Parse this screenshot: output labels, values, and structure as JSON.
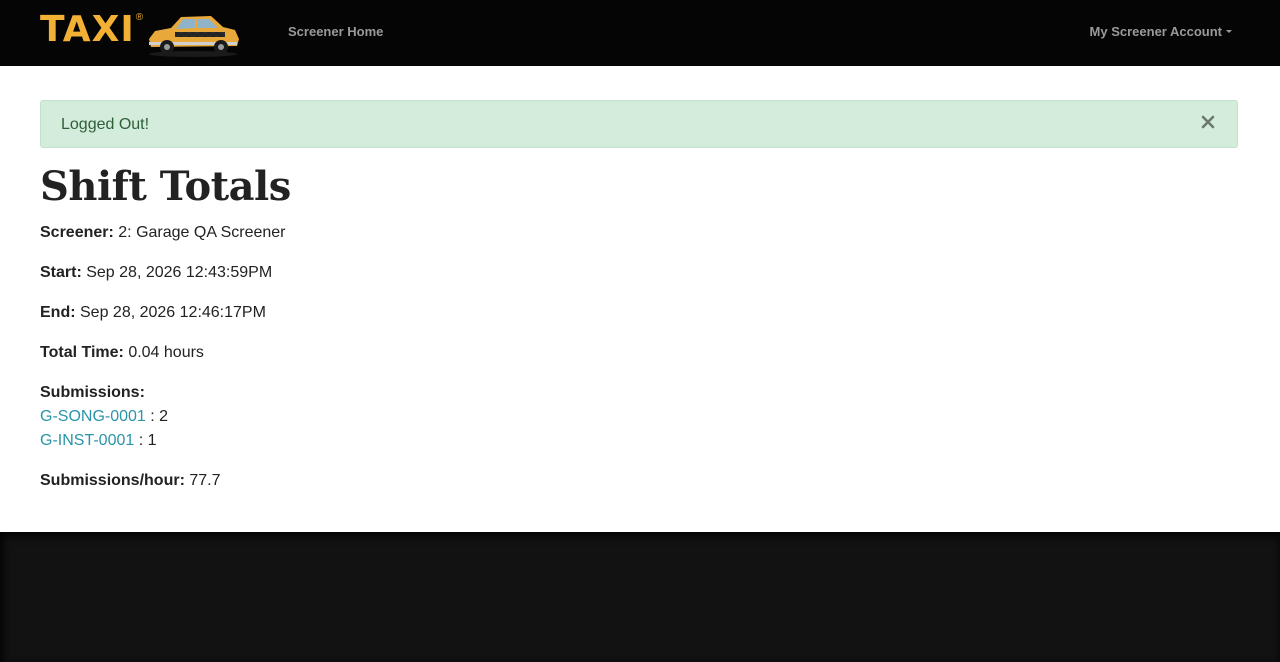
{
  "navbar": {
    "brand_text": "TAXI",
    "brand_mark": "®",
    "home_link": "Screener Home",
    "account_menu": "My Screener Account"
  },
  "alert": {
    "message": "Logged Out!",
    "close_label": "×"
  },
  "page": {
    "title": "Shift Totals"
  },
  "shift": {
    "screener_label": "Screener:",
    "screener_value": "2: Garage QA Screener",
    "start_label": "Start:",
    "start_value": "Sep 28, 2026 12:43:59PM",
    "end_label": "End:",
    "end_value": "Sep 28, 2026 12:46:17PM",
    "total_label": "Total Time:",
    "total_value": "0.04 hours",
    "submissions_label": "Submissions:",
    "submissions": [
      {
        "code": "G-SONG-0001",
        "sep": " : ",
        "count": "2"
      },
      {
        "code": "G-INST-0001",
        "sep": " : ",
        "count": "1"
      }
    ],
    "rate_label": "Submissions/hour:",
    "rate_value": "77.7"
  },
  "colors": {
    "navbar_bg": "#050505",
    "brand_gold": "#f2b134",
    "alert_bg": "#d4ecdb",
    "alert_text": "#2f5f3a",
    "link": "#2a95a8",
    "footer_bg": "#121212"
  },
  "icons": {
    "brand_car": "taxi-cab-icon",
    "account_caret": "caret-down-icon",
    "alert_close": "close-icon"
  }
}
